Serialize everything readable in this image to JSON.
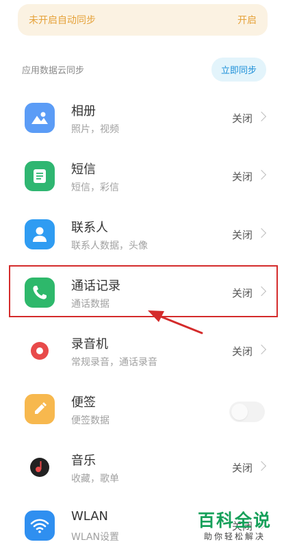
{
  "banner": {
    "text": "未开启自动同步",
    "action": "开启"
  },
  "section": {
    "title": "应用数据云同步",
    "sync_button": "立即同步"
  },
  "apps": [
    {
      "name": "相册",
      "desc": "照片，视频",
      "status": "关闭",
      "icon": "gallery-icon",
      "color": "#5b9cf6"
    },
    {
      "name": "短信",
      "desc": "短信，彩信",
      "status": "关闭",
      "icon": "message-icon",
      "color": "#2fb671"
    },
    {
      "name": "联系人",
      "desc": "联系人数据，头像",
      "status": "关闭",
      "icon": "contacts-icon",
      "color": "#2f9cf2"
    },
    {
      "name": "通话记录",
      "desc": "通话数据",
      "status": "关闭",
      "icon": "phone-icon",
      "color": "#2eb86b"
    },
    {
      "name": "录音机",
      "desc": "常规录音，通话录音",
      "status": "关闭",
      "icon": "recorder-icon",
      "color": "#e84a4a"
    },
    {
      "name": "便签",
      "desc": "便签数据",
      "status": "",
      "toggle_on": false,
      "icon": "notes-icon",
      "color": "#f7b84e"
    },
    {
      "name": "音乐",
      "desc": "收藏，歌单",
      "status": "关闭",
      "icon": "music-icon",
      "color": "#222222"
    },
    {
      "name": "WLAN",
      "desc": "WLAN设置",
      "status": "关闭",
      "icon": "wifi-icon",
      "color": "#2f8ff0"
    }
  ],
  "watermark": {
    "title": "百科全说",
    "subtitle": "助你轻松解决"
  },
  "colors": {
    "highlight": "#d42b2b",
    "accent": "#e5a23a",
    "link": "#1d8fd8"
  }
}
